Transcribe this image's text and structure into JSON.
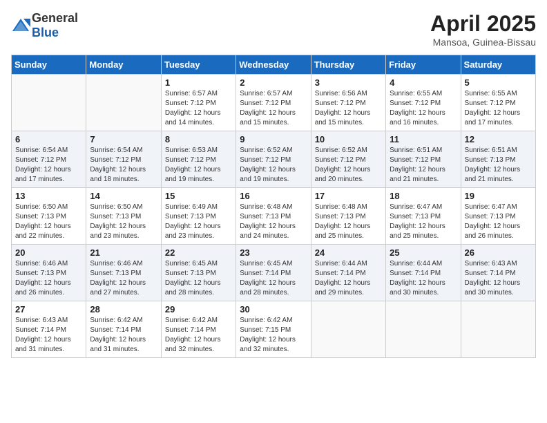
{
  "header": {
    "logo_general": "General",
    "logo_blue": "Blue",
    "month": "April 2025",
    "location": "Mansoa, Guinea-Bissau"
  },
  "weekdays": [
    "Sunday",
    "Monday",
    "Tuesday",
    "Wednesday",
    "Thursday",
    "Friday",
    "Saturday"
  ],
  "weeks": [
    [
      {
        "day": "",
        "info": ""
      },
      {
        "day": "",
        "info": ""
      },
      {
        "day": "1",
        "info": "Sunrise: 6:57 AM\nSunset: 7:12 PM\nDaylight: 12 hours and 14 minutes."
      },
      {
        "day": "2",
        "info": "Sunrise: 6:57 AM\nSunset: 7:12 PM\nDaylight: 12 hours and 15 minutes."
      },
      {
        "day": "3",
        "info": "Sunrise: 6:56 AM\nSunset: 7:12 PM\nDaylight: 12 hours and 15 minutes."
      },
      {
        "day": "4",
        "info": "Sunrise: 6:55 AM\nSunset: 7:12 PM\nDaylight: 12 hours and 16 minutes."
      },
      {
        "day": "5",
        "info": "Sunrise: 6:55 AM\nSunset: 7:12 PM\nDaylight: 12 hours and 17 minutes."
      }
    ],
    [
      {
        "day": "6",
        "info": "Sunrise: 6:54 AM\nSunset: 7:12 PM\nDaylight: 12 hours and 17 minutes."
      },
      {
        "day": "7",
        "info": "Sunrise: 6:54 AM\nSunset: 7:12 PM\nDaylight: 12 hours and 18 minutes."
      },
      {
        "day": "8",
        "info": "Sunrise: 6:53 AM\nSunset: 7:12 PM\nDaylight: 12 hours and 19 minutes."
      },
      {
        "day": "9",
        "info": "Sunrise: 6:52 AM\nSunset: 7:12 PM\nDaylight: 12 hours and 19 minutes."
      },
      {
        "day": "10",
        "info": "Sunrise: 6:52 AM\nSunset: 7:12 PM\nDaylight: 12 hours and 20 minutes."
      },
      {
        "day": "11",
        "info": "Sunrise: 6:51 AM\nSunset: 7:12 PM\nDaylight: 12 hours and 21 minutes."
      },
      {
        "day": "12",
        "info": "Sunrise: 6:51 AM\nSunset: 7:13 PM\nDaylight: 12 hours and 21 minutes."
      }
    ],
    [
      {
        "day": "13",
        "info": "Sunrise: 6:50 AM\nSunset: 7:13 PM\nDaylight: 12 hours and 22 minutes."
      },
      {
        "day": "14",
        "info": "Sunrise: 6:50 AM\nSunset: 7:13 PM\nDaylight: 12 hours and 23 minutes."
      },
      {
        "day": "15",
        "info": "Sunrise: 6:49 AM\nSunset: 7:13 PM\nDaylight: 12 hours and 23 minutes."
      },
      {
        "day": "16",
        "info": "Sunrise: 6:48 AM\nSunset: 7:13 PM\nDaylight: 12 hours and 24 minutes."
      },
      {
        "day": "17",
        "info": "Sunrise: 6:48 AM\nSunset: 7:13 PM\nDaylight: 12 hours and 25 minutes."
      },
      {
        "day": "18",
        "info": "Sunrise: 6:47 AM\nSunset: 7:13 PM\nDaylight: 12 hours and 25 minutes."
      },
      {
        "day": "19",
        "info": "Sunrise: 6:47 AM\nSunset: 7:13 PM\nDaylight: 12 hours and 26 minutes."
      }
    ],
    [
      {
        "day": "20",
        "info": "Sunrise: 6:46 AM\nSunset: 7:13 PM\nDaylight: 12 hours and 26 minutes."
      },
      {
        "day": "21",
        "info": "Sunrise: 6:46 AM\nSunset: 7:13 PM\nDaylight: 12 hours and 27 minutes."
      },
      {
        "day": "22",
        "info": "Sunrise: 6:45 AM\nSunset: 7:13 PM\nDaylight: 12 hours and 28 minutes."
      },
      {
        "day": "23",
        "info": "Sunrise: 6:45 AM\nSunset: 7:14 PM\nDaylight: 12 hours and 28 minutes."
      },
      {
        "day": "24",
        "info": "Sunrise: 6:44 AM\nSunset: 7:14 PM\nDaylight: 12 hours and 29 minutes."
      },
      {
        "day": "25",
        "info": "Sunrise: 6:44 AM\nSunset: 7:14 PM\nDaylight: 12 hours and 30 minutes."
      },
      {
        "day": "26",
        "info": "Sunrise: 6:43 AM\nSunset: 7:14 PM\nDaylight: 12 hours and 30 minutes."
      }
    ],
    [
      {
        "day": "27",
        "info": "Sunrise: 6:43 AM\nSunset: 7:14 PM\nDaylight: 12 hours and 31 minutes."
      },
      {
        "day": "28",
        "info": "Sunrise: 6:42 AM\nSunset: 7:14 PM\nDaylight: 12 hours and 31 minutes."
      },
      {
        "day": "29",
        "info": "Sunrise: 6:42 AM\nSunset: 7:14 PM\nDaylight: 12 hours and 32 minutes."
      },
      {
        "day": "30",
        "info": "Sunrise: 6:42 AM\nSunset: 7:15 PM\nDaylight: 12 hours and 32 minutes."
      },
      {
        "day": "",
        "info": ""
      },
      {
        "day": "",
        "info": ""
      },
      {
        "day": "",
        "info": ""
      }
    ]
  ]
}
